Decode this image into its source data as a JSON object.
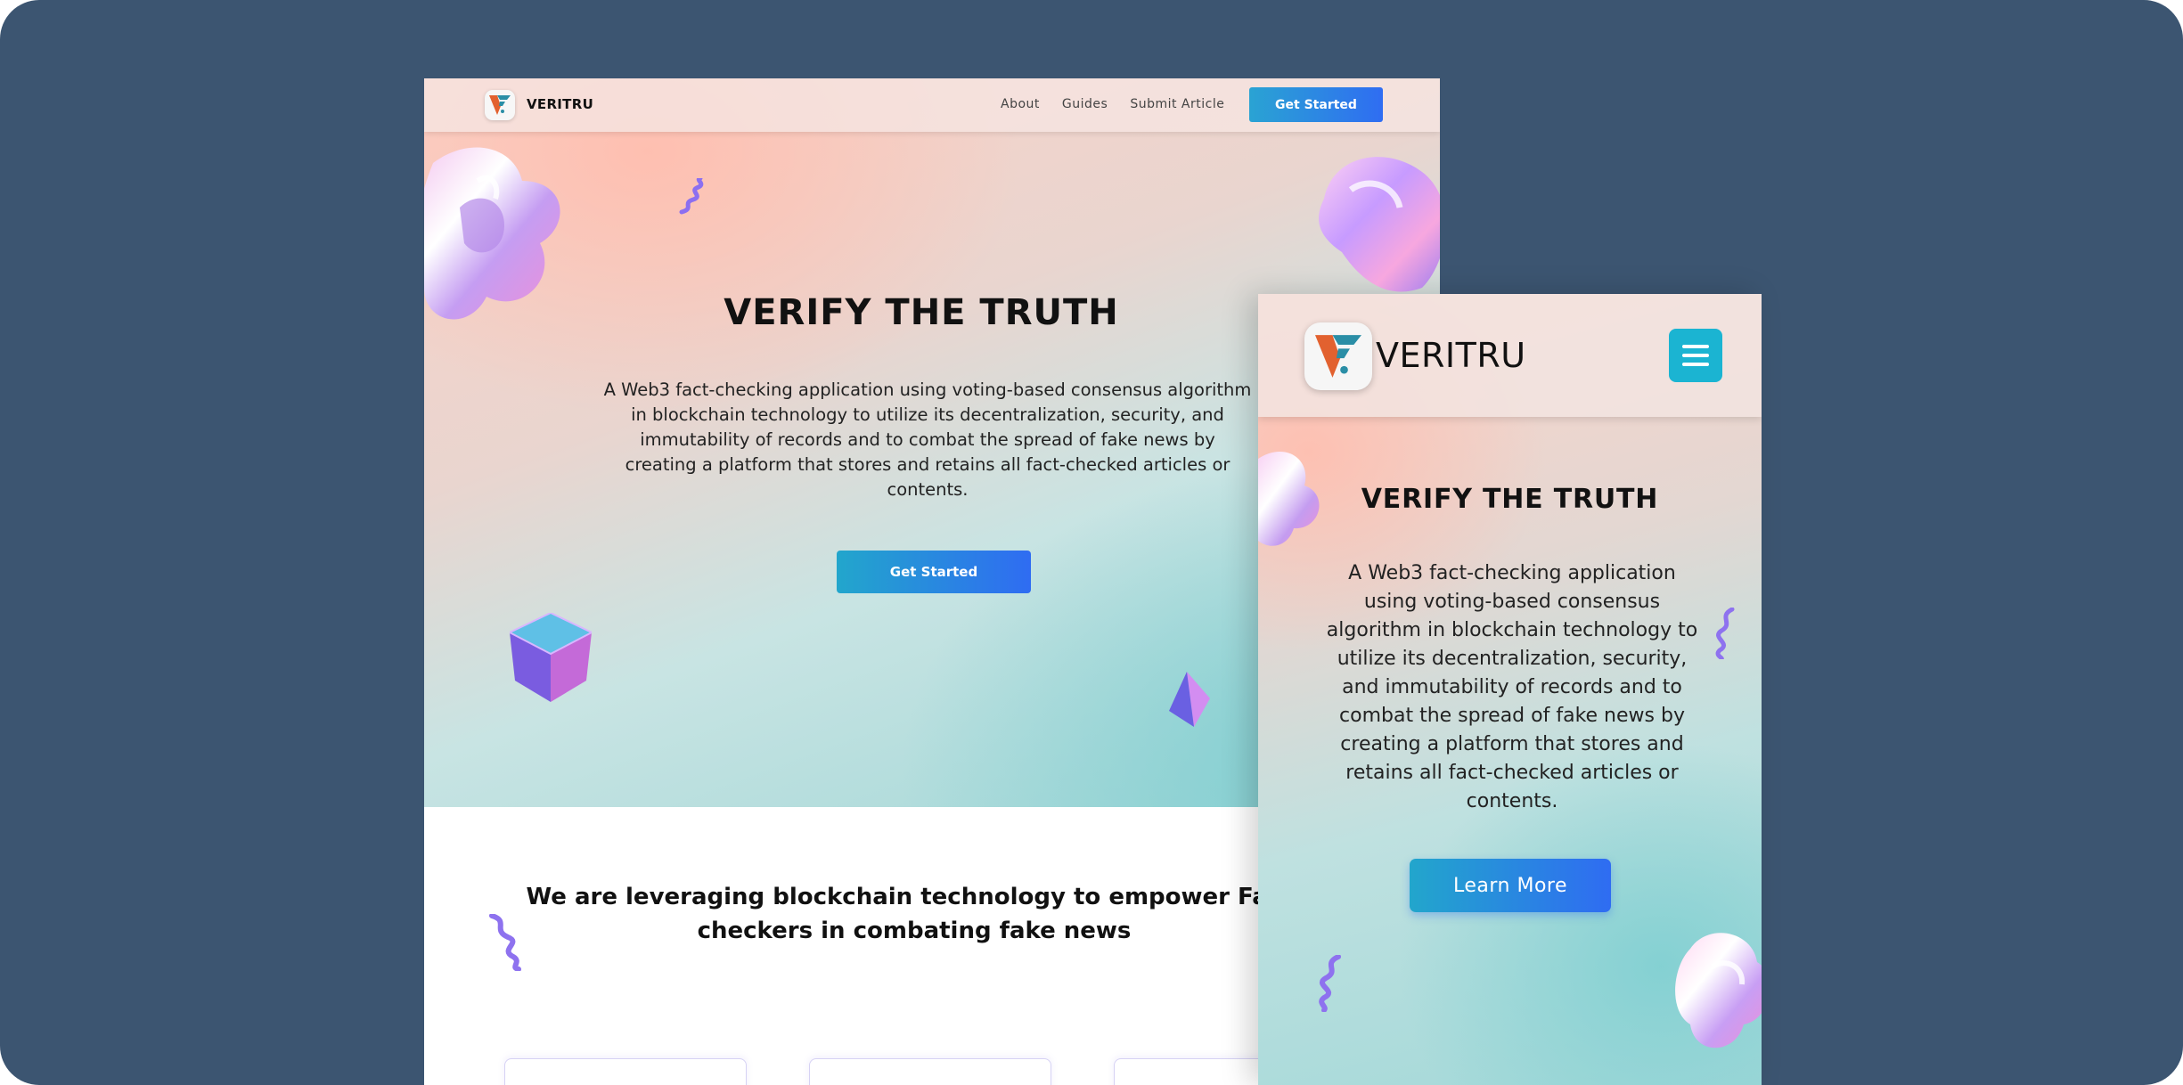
{
  "desktop": {
    "nav": {
      "brand": "VERITRU",
      "links": [
        "About",
        "Guides",
        "Submit Article"
      ],
      "cta_label": "Get Started"
    },
    "hero": {
      "title": "VERIFY THE TRUTH",
      "description": "A Web3 fact-checking application using voting-based consensus algorithm in blockchain technology to utilize its decentralization, security, and immutability of records and to combat the spread of fake news by creating a platform that stores and retains all fact-checked articles or contents.",
      "button_label": "Get Started"
    },
    "section": {
      "title": "We are leveraging blockchain technology to empower Fact-checkers in combating fake news"
    }
  },
  "mobile": {
    "nav": {
      "brand": "VERITRU",
      "menu_icon": "hamburger-menu-icon"
    },
    "hero": {
      "title": "VERIFY THE TRUTH",
      "description": "A Web3 fact-checking application using voting-based consensus algorithm in blockchain technology to utilize its decentralization, security, and immutability of records and to combat the spread of fake news by creating a platform that stores and retains all fact-checked articles or contents.",
      "button_label": "Learn More"
    }
  },
  "colors": {
    "frame_background": "#3c5571",
    "button_gradient_start": "#22a6cc",
    "button_gradient_end": "#2f6cf2",
    "menu_button": "#1bb4d2"
  }
}
